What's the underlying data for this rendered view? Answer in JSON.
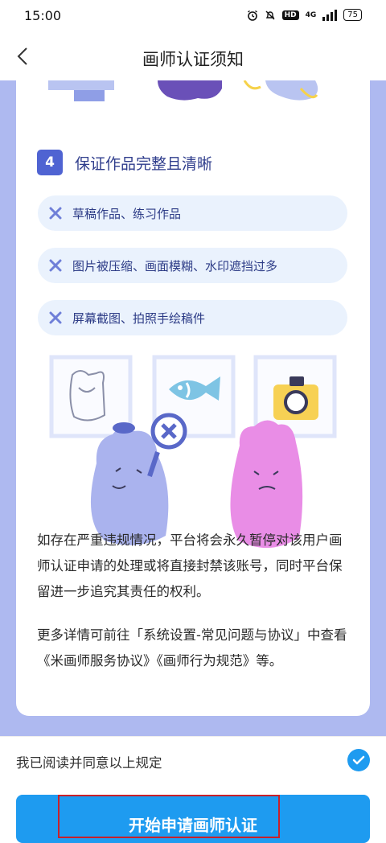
{
  "status_bar": {
    "time": "15:00",
    "network": "4G",
    "hd": "HD",
    "battery": "75",
    "icons": [
      "alarm-icon",
      "mute-bell-icon",
      "hd-icon",
      "signal-icon",
      "battery-icon"
    ]
  },
  "header": {
    "title": "画师认证须知",
    "back_icon": "chevron-left-icon"
  },
  "section": {
    "number": "4",
    "title": "保证作品完整且清晰",
    "rules": [
      "草稿作品、练习作品",
      "图片被压缩、画面模糊、水印遮挡过多",
      "屏幕截图、拍照手绘稿件"
    ]
  },
  "paragraphs": {
    "p1": "如存在严重违规情况，平台将会永久暂停对该用户画师认证申请的处理或将直接封禁该账号，同时平台保留进一步追究其责任的权利。",
    "p2": "更多详情可前往「系统设置-常见问题与协议」中查看《米画师服务协议》《画师行为规范》等。"
  },
  "agreement": {
    "label": "我已阅读并同意以上规定",
    "checked": true
  },
  "cta": {
    "label": "开始申请画师认证"
  },
  "colors": {
    "accent_blue": "#1e9bf0",
    "badge_blue": "#4f63d2",
    "panel_bg": "#aeb9f0",
    "rule_bg": "#eaf2fd",
    "highlight_red": "#c8202a"
  }
}
